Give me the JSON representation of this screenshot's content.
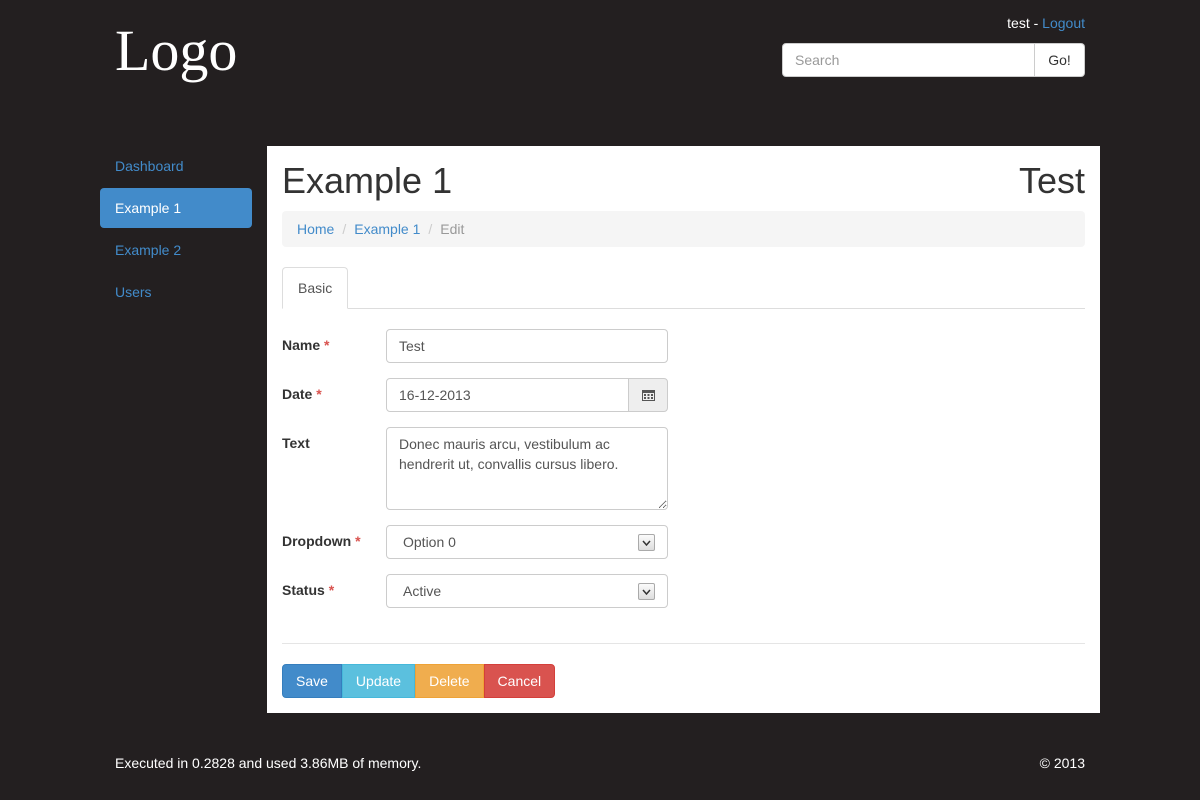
{
  "header": {
    "logo": "Logo",
    "username": "test",
    "separator": " - ",
    "logout_label": "Logout",
    "search_placeholder": "Search",
    "search_button": "Go!"
  },
  "sidebar": {
    "items": [
      {
        "label": "Dashboard",
        "active": false
      },
      {
        "label": "Example 1",
        "active": true
      },
      {
        "label": "Example 2",
        "active": false
      },
      {
        "label": "Users",
        "active": false
      }
    ]
  },
  "main": {
    "title": "Example 1",
    "title_right": "Test",
    "breadcrumb": [
      "Home",
      "Example 1",
      "Edit"
    ],
    "breadcrumb_separator": "/",
    "tabs": [
      {
        "label": "Basic"
      }
    ],
    "form": {
      "required_mark": "*",
      "name": {
        "label": "Name",
        "value": "Test"
      },
      "date": {
        "label": "Date",
        "value": "16-12-2013",
        "icon": "calendar-icon"
      },
      "text": {
        "label": "Text",
        "value": "Donec mauris arcu, vestibulum ac hendrerit ut, convallis cursus libero."
      },
      "dropdown": {
        "label": "Dropdown",
        "value": "Option 0"
      },
      "status": {
        "label": "Status",
        "value": "Active"
      }
    },
    "buttons": {
      "save": "Save",
      "update": "Update",
      "delete": "Delete",
      "cancel": "Cancel"
    }
  },
  "footer": {
    "stats": "Executed in 0.2828 and used 3.86MB of memory.",
    "copyright": "© 2013"
  },
  "colors": {
    "background": "#231f20",
    "primary": "#428bca",
    "info": "#5bc0de",
    "warning": "#f0ad4e",
    "danger": "#d9534f"
  }
}
